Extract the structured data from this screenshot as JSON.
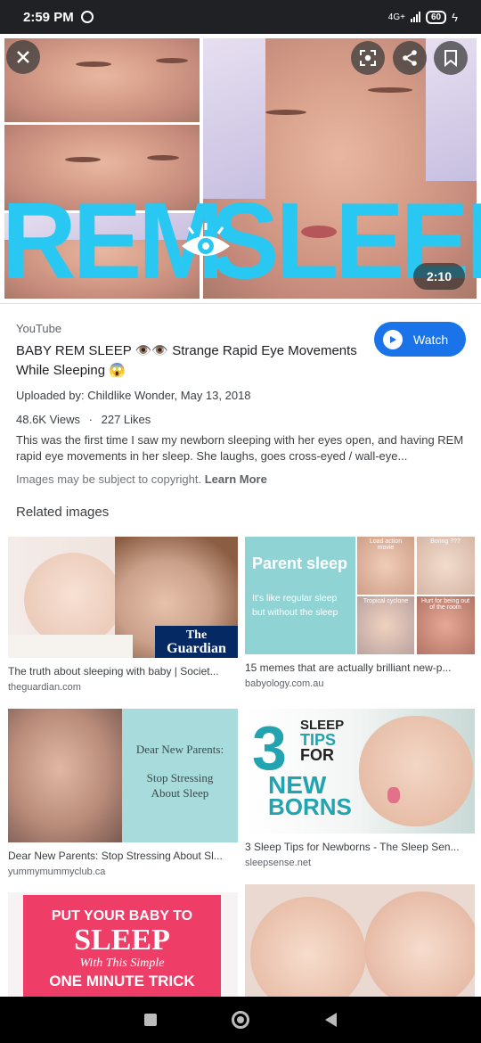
{
  "status_bar": {
    "time": "2:59 PM",
    "network": "4G+",
    "battery": "60"
  },
  "hero": {
    "headline_word_1": "REM",
    "headline_word_2": "SLEEP",
    "duration": "2:10",
    "icons": [
      "close-icon",
      "lens-icon",
      "share-icon",
      "bookmark-icon"
    ]
  },
  "result": {
    "source": "YouTube",
    "title": "BABY REM SLEEP 👁️👁️ Strange Rapid Eye Movements While Sleeping 😱",
    "watch_label": "Watch",
    "uploaded": "Uploaded by: Childlike Wonder, May 13, 2018",
    "views": "48.6K Views",
    "likes": "227 Likes",
    "separator": "·",
    "description": "This was the first time I saw my newborn sleeping with her eyes open, and having REM rapid eye movements in her sleep. She laughs, goes cross-eyed / wall-eye...",
    "copyright_text": "Images may be subject to copyright.",
    "learn_more": "Learn More"
  },
  "related": {
    "heading": "Related images",
    "items": [
      {
        "caption": "The truth about sleeping with baby | Societ...",
        "site": "theguardian.com",
        "overlay": [
          "The",
          "Guardian"
        ]
      },
      {
        "caption": "15 memes that are actually brilliant new-p...",
        "site": "babyology.com.au",
        "overlay": [
          "Parent sleep",
          "It's like regular sleep",
          "but without the sleep"
        ],
        "mini_labels": [
          "Load action movie",
          "Boring ???",
          "Tropical cyclone",
          "Hurt for being out of the room"
        ]
      },
      {
        "caption": "Dear New Parents: Stop Stressing About Sl...",
        "site": "yummymummyclub.ca",
        "overlay": [
          "Dear New Parents:",
          "Stop Stressing",
          "About Sleep"
        ]
      },
      {
        "caption": "3 Sleep Tips for Newborns - The Sleep Sen...",
        "site": "sleepsense.net",
        "overlay": [
          "3",
          "SLEEP",
          "TIPS",
          "FOR",
          "NEW",
          "BORNS"
        ]
      },
      {
        "overlay": [
          "PUT YOUR BABY TO",
          "SLEEP",
          "With This Simple",
          "ONE MINUTE TRICK"
        ]
      },
      {}
    ]
  },
  "colors": {
    "accent": "#1a73e8",
    "rem_cyan": "#29c8f2",
    "guardian_navy": "#052962",
    "teal_panel": "#8fd3d4",
    "pink_banner": "#ee3d67"
  }
}
